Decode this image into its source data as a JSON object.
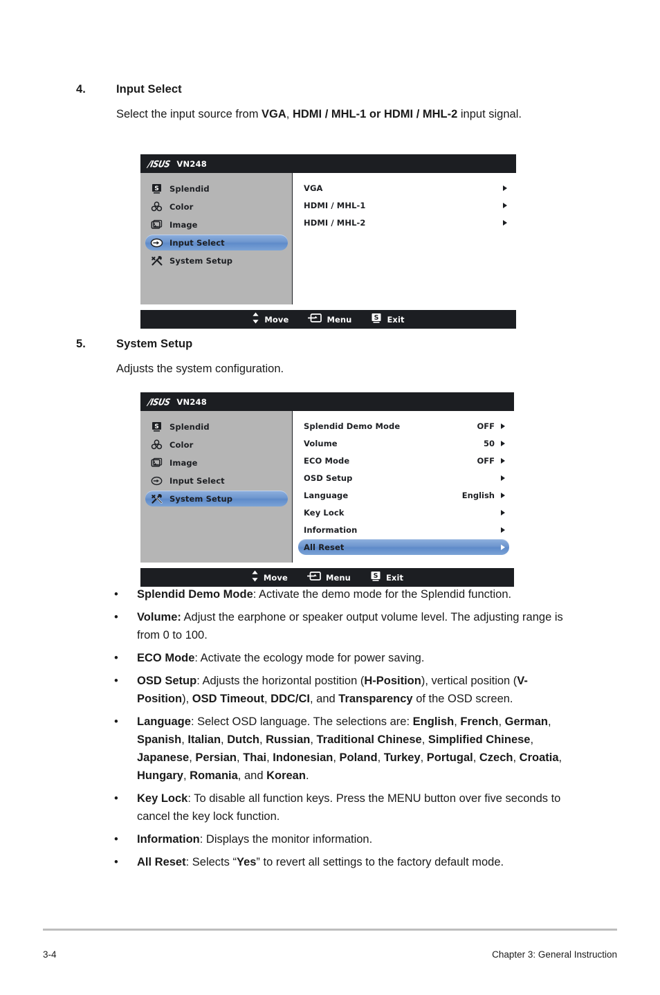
{
  "section4": {
    "number": "4.",
    "title": "Input Select",
    "body_html": "Select the input source from <b>VGA</b>, <b>HDMI / MHL-1 or HDMI / MHL-2</b> input signal."
  },
  "section5": {
    "number": "5.",
    "title": "System Setup",
    "body_html": "Adjusts the system configuration."
  },
  "osd_input_select": {
    "brand": "/ISUS",
    "model": "VN248",
    "sidebar": [
      {
        "label": "Splendid",
        "icon": "splendid-icon",
        "active": false
      },
      {
        "label": "Color",
        "icon": "color-icon",
        "active": false
      },
      {
        "label": "Image",
        "icon": "image-icon",
        "active": false
      },
      {
        "label": "Input Select",
        "icon": "input-select-icon",
        "active": true
      },
      {
        "label": "System Setup",
        "icon": "system-setup-icon",
        "active": false
      }
    ],
    "rows": [
      {
        "label": "VGA",
        "value": "",
        "active": false
      },
      {
        "label": "HDMI / MHL-1",
        "value": "",
        "active": false
      },
      {
        "label": "HDMI / MHL-2",
        "value": "",
        "active": false
      }
    ],
    "footer": [
      {
        "label": "Move",
        "icon": "up-down-arrow-icon"
      },
      {
        "label": "Menu",
        "icon": "menu-enter-icon"
      },
      {
        "label": "Exit",
        "icon": "splendid-s-icon"
      }
    ]
  },
  "osd_system_setup": {
    "brand": "/ISUS",
    "model": "VN248",
    "sidebar": [
      {
        "label": "Splendid",
        "icon": "splendid-icon",
        "active": false
      },
      {
        "label": "Color",
        "icon": "color-icon",
        "active": false
      },
      {
        "label": "Image",
        "icon": "image-icon",
        "active": false
      },
      {
        "label": "Input Select",
        "icon": "input-select-icon",
        "active": false
      },
      {
        "label": "System Setup",
        "icon": "system-setup-icon",
        "active": true
      }
    ],
    "rows": [
      {
        "label": "Splendid Demo Mode",
        "value": "OFF",
        "active": false
      },
      {
        "label": "Volume",
        "value": "50",
        "active": false
      },
      {
        "label": "ECO Mode",
        "value": "OFF",
        "active": false
      },
      {
        "label": "OSD Setup",
        "value": "",
        "active": false
      },
      {
        "label": "Language",
        "value": "English",
        "active": false
      },
      {
        "label": "Key Lock",
        "value": "",
        "active": false
      },
      {
        "label": "Information",
        "value": "",
        "active": false
      },
      {
        "label": "All Reset",
        "value": "",
        "active": true
      }
    ],
    "footer": [
      {
        "label": "Move",
        "icon": "up-down-arrow-icon"
      },
      {
        "label": "Menu",
        "icon": "menu-enter-icon"
      },
      {
        "label": "Exit",
        "icon": "splendid-s-icon"
      }
    ]
  },
  "bullets": [
    {
      "marker": "•",
      "html": "<b>Splendid Demo Mode</b>: Activate the demo mode for the Splendid function."
    },
    {
      "marker": "•",
      "html": "<b>Volume:</b> Adjust the earphone or speaker output volume level. The adjusting range is from 0 to 100."
    },
    {
      "marker": "•",
      "html": "<b>ECO Mode</b>: Activate the ecology mode for power saving."
    },
    {
      "marker": "•",
      "html": "<b>OSD Setup</b>: Adjusts the horizontal postition (<b>H-Position</b>), vertical position (<b>V-Position</b>), <b>OSD Timeout</b>, <b>DDC/CI</b>, and <b>Transparency</b> of the OSD screen."
    },
    {
      "marker": "•",
      "html": "<b>Language</b>: Select OSD language. The selections are: <b>English</b>, <b>French</b>, <b>German</b>, <b>Spanish</b>, <b>Italian</b>, <b>Dutch</b>, <b>Russian</b>, <b>Traditional Chinese</b>, <b>Simplified Chinese</b>, <b>Japanese</b>, <b>Persian</b>, <b>Thai</b>, <b>Indonesian</b>, <b>Poland</b>, <b>Turkey</b>, <b>Portugal</b>, <b>Czech</b>, <b>Croatia</b>, <b>Hungary</b>, <b>Romania</b>, and <b>Korean</b>."
    },
    {
      "marker": "•",
      "html": "<b>Key Lock</b>: To disable all function keys. Press the MENU button over five seconds to cancel the key lock function."
    },
    {
      "marker": "•",
      "html": "<b>Information</b>: Displays the monitor information."
    },
    {
      "marker": "•",
      "html": "<b>All Reset</b>: Selects “<b>Yes</b>” to revert all settings to the factory default mode."
    }
  ],
  "footer": {
    "page_number": "3-4",
    "chapter": "Chapter 3: General Instruction"
  },
  "colors": {
    "osd_chrome": "#1c1e22",
    "osd_sidebar": "#b5b5b5",
    "osd_panel": "#ffffff",
    "highlight_blue": "#6f97cf",
    "rule_gray": "#bdbdbd"
  }
}
